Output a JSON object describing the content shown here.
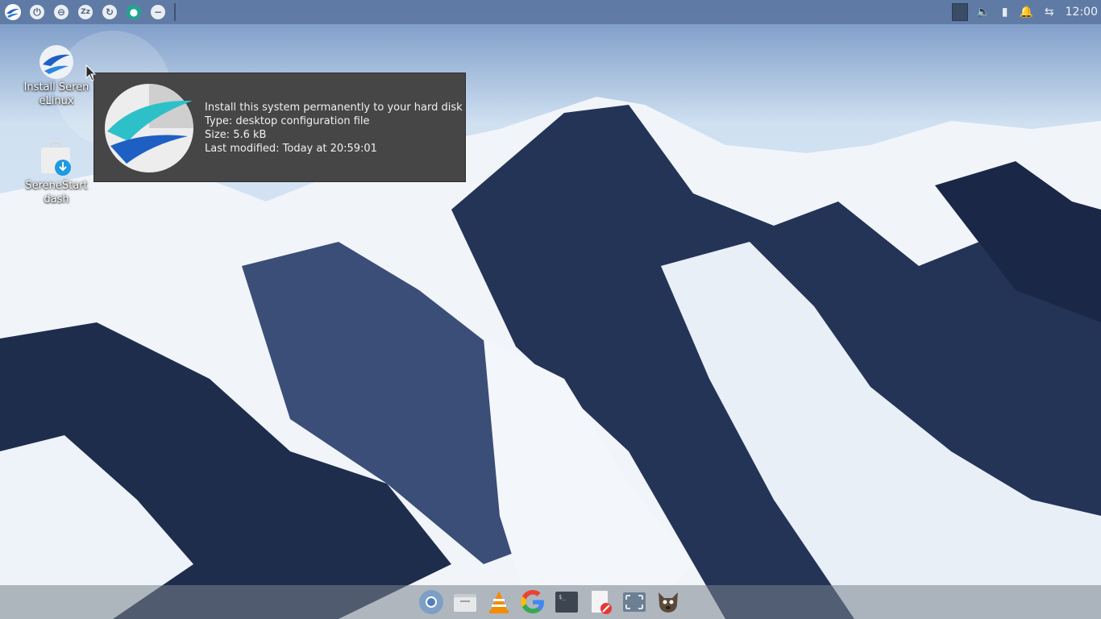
{
  "top_panel": {
    "left_buttons": [
      "serene-logo-icon",
      "power-icon",
      "lock-icon",
      "suspend-icon",
      "restart-icon",
      "user-icon",
      "logout-icon"
    ],
    "tray": [
      "workspace-switcher",
      "volume-icon",
      "battery-icon",
      "notification-bell-icon",
      "network-icon"
    ],
    "clock": "12:00"
  },
  "desktop": {
    "icons": [
      {
        "label": "Install SereneLinux",
        "icon": "serene-installer-icon"
      },
      {
        "label": "SereneStartdash",
        "icon": "startdash-briefcase-icon"
      }
    ]
  },
  "tooltip": {
    "line1": "Install this system permanently to your hard disk",
    "line2": "Type: desktop configuration file",
    "line3": "Size: 5.6 kB",
    "line4": "Last modified: Today at 20:59:01"
  },
  "dock": {
    "items": [
      "chromium-icon",
      "file-manager-icon",
      "vlc-icon",
      "google-icon",
      "terminal-icon",
      "text-editor-icon",
      "screenshot-icon",
      "gimp-icon"
    ]
  },
  "colors": {
    "panel": "#5c78a0",
    "tooltip_bg": "#464646",
    "accent_teal": "#1fa58f",
    "serene_blue": "#1e5fc4"
  }
}
